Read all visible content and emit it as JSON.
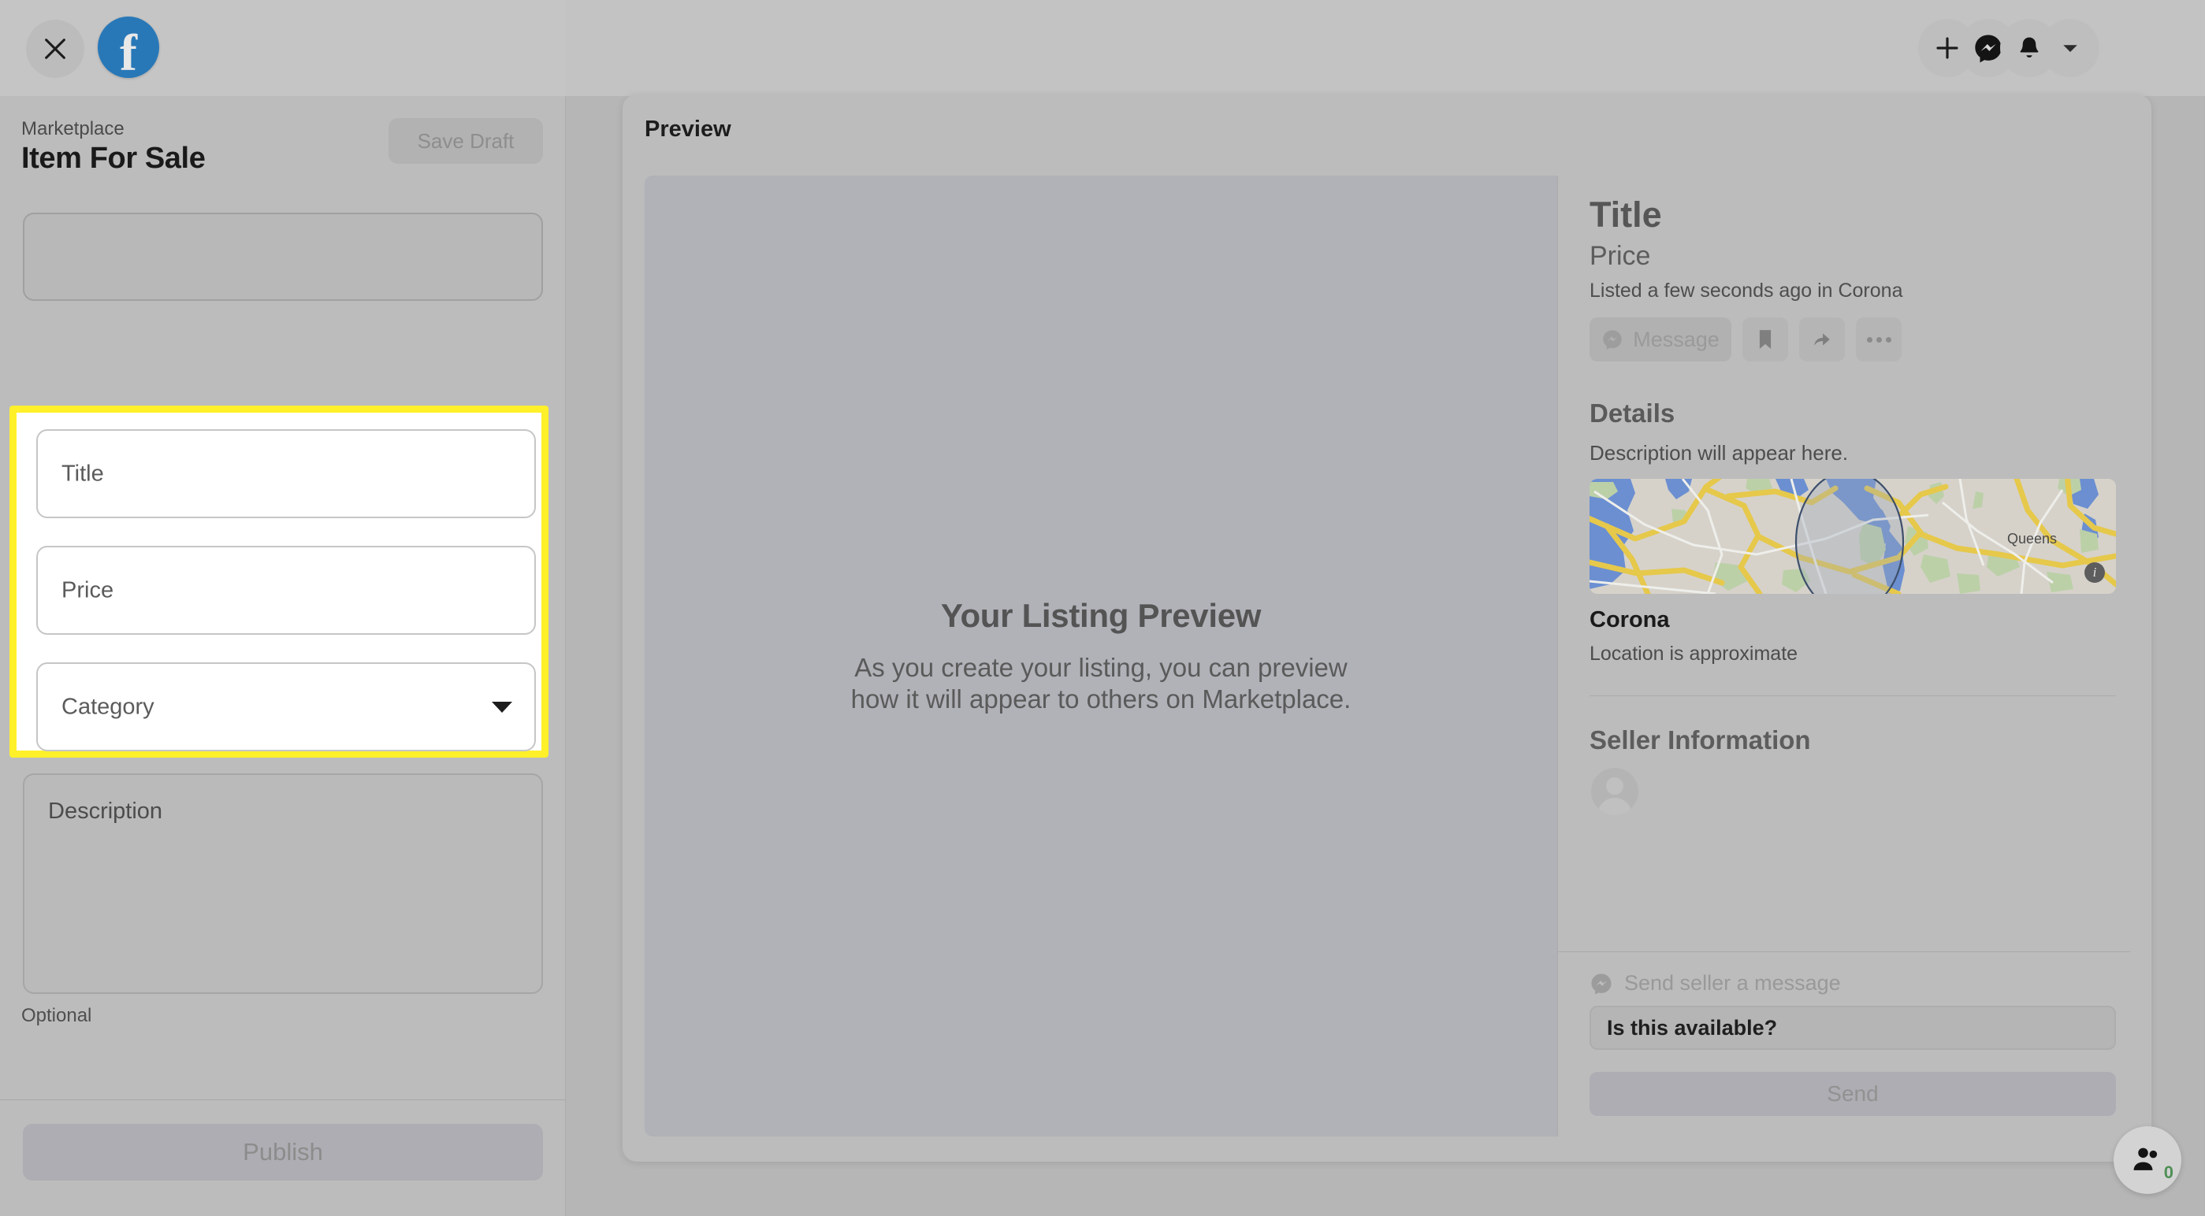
{
  "topbar": {
    "close_icon": "close-icon",
    "logo_letter": "f",
    "logo_name": "facebook-logo",
    "icons": [
      {
        "name": "create-icon",
        "glyph": "plus"
      },
      {
        "name": "messenger-icon",
        "glyph": "messenger"
      },
      {
        "name": "notifications-icon",
        "glyph": "bell"
      },
      {
        "name": "account-menu-icon",
        "glyph": "chevron-down"
      }
    ]
  },
  "composer": {
    "breadcrumb": "Marketplace",
    "title": "Item For Sale",
    "save_draft_label": "Save Draft",
    "photo_box_name": "photo-upload-box",
    "fields": [
      {
        "name": "title-input",
        "placeholder": "Title"
      },
      {
        "name": "price-input",
        "placeholder": "Price"
      },
      {
        "name": "category-select",
        "placeholder": "Category"
      }
    ],
    "description_placeholder": "Description",
    "optional_label": "Optional",
    "publish_label": "Publish"
  },
  "preview": {
    "heading": "Preview",
    "photo_pane": {
      "title": "Your Listing Preview",
      "subtitle_line1": "As you create your listing, you can preview",
      "subtitle_line2": "how it will appear to others on Marketplace."
    },
    "detail": {
      "title": "Title",
      "price": "Price",
      "listed": "Listed a few seconds ago in Corona",
      "message_button": "Message",
      "save_icon": "bookmark-icon",
      "share_icon": "share-icon",
      "more_icon": "more-options-icon",
      "details_heading": "Details",
      "description_placeholder": "Description will appear here.",
      "map_label": "Queens",
      "map_info_glyph": "i",
      "location_name": "Corona",
      "location_note": "Location is approximate",
      "seller_heading": "Seller Information"
    },
    "message_box": {
      "prompt": "Send seller a message",
      "input_value": "Is this available?",
      "send_label": "Send"
    }
  },
  "contacts": {
    "icon": "contacts-icon",
    "badge": "0"
  },
  "colors": {
    "highlight": "#fff02a",
    "facebook_blue": "#2878b8",
    "page_bg": "#b6b6b6",
    "map_road": "#e6c84b",
    "map_water": "#6b8fd1",
    "map_park": "#bcd0a8",
    "badge_green": "#4f8f57"
  }
}
